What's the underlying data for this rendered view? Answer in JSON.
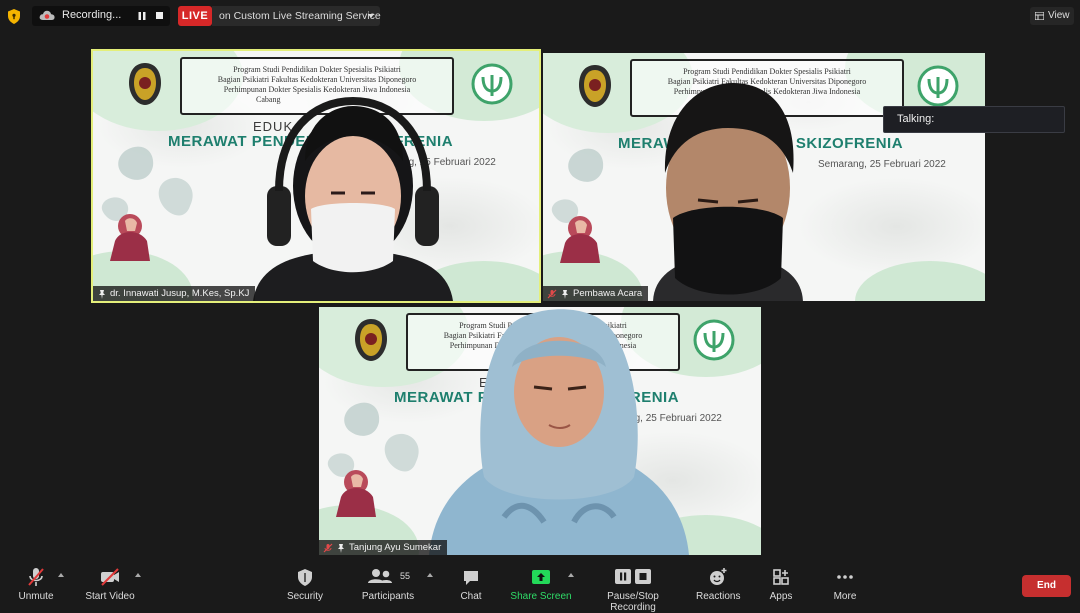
{
  "top_bar": {
    "recording_label": "Recording...",
    "live_badge": "LIVE",
    "stream_label": "on Custom Live Streaming Service",
    "view_label": "View"
  },
  "slide": {
    "header_lines": [
      "Program Studi Pendidikan Dokter Spesialis Psikiatri",
      "Bagian Psikiatri Fakultas Kedokteran Universitas Diponegoro",
      "Perhimpunan Dokter Spesialis Kedokteran Jiwa Indonesia",
      "Cabang"
    ],
    "edu_text": "EDUK",
    "title": "MERAWAT PENDERITA SKIZOFRENIA",
    "date": "Semarang, 25 Februari 2022",
    "accent_color": "#1e7f6e"
  },
  "participants": [
    {
      "name": "dr. Innawati Jusup, M.Kes, Sp.KJ",
      "muted": false,
      "active_speaker": true
    },
    {
      "name": "Pembawa Acara",
      "muted": true,
      "active_speaker": false
    },
    {
      "name": "Tanjung Ayu Sumekar",
      "muted": true,
      "active_speaker": false
    }
  ],
  "talking_popup": {
    "label": "Talking:"
  },
  "toolbar": {
    "unmute": "Unmute",
    "start_video": "Start Video",
    "security": "Security",
    "participants": "Participants",
    "participants_count": "55",
    "chat": "Chat",
    "share_screen": "Share Screen",
    "pause_stop_recording": "Pause/Stop Recording",
    "reactions": "Reactions",
    "apps": "Apps",
    "more": "More",
    "end": "End"
  },
  "colors": {
    "live": "#d62828",
    "share": "#23d959",
    "end": "#c62f2f",
    "active_border": "#e4ef7a"
  }
}
